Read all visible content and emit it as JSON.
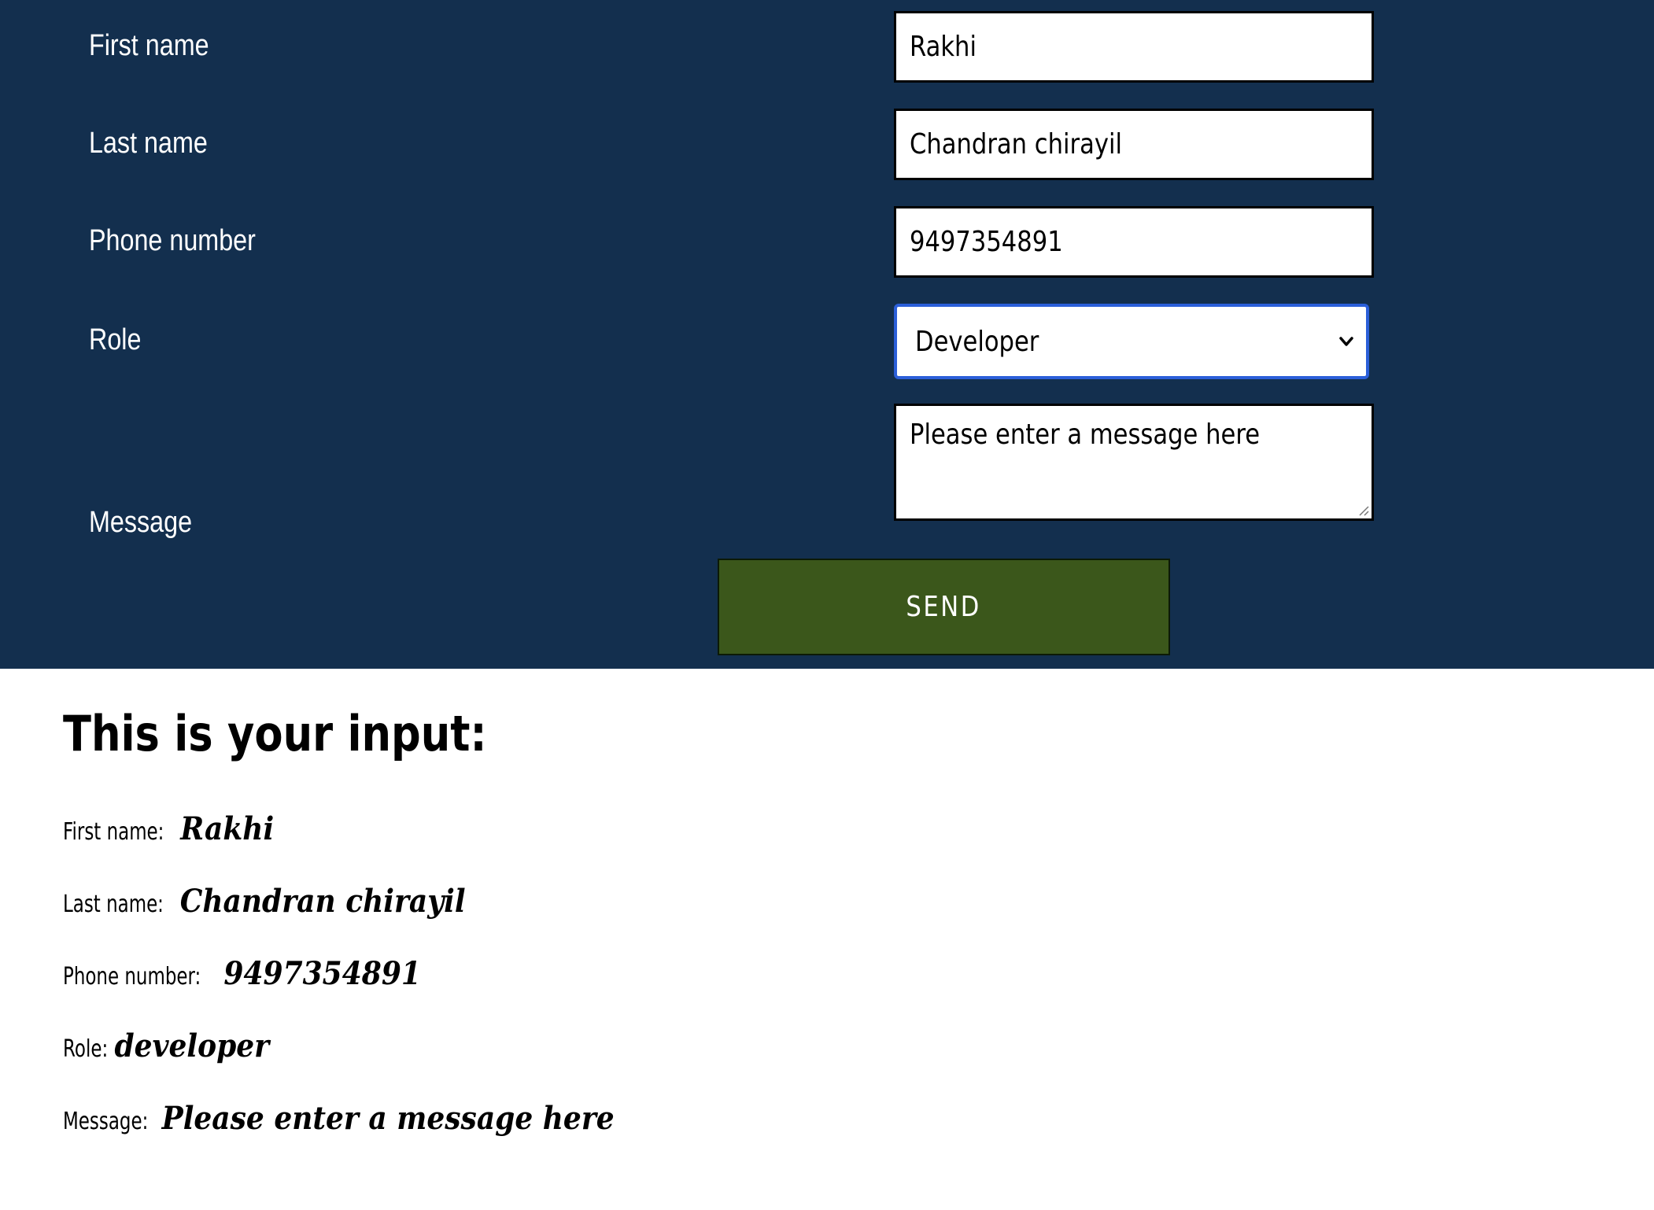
{
  "form": {
    "fields": {
      "first_name": {
        "label": "First name",
        "value": "Rakhi"
      },
      "last_name": {
        "label": "Last name",
        "value": "Chandran chirayil"
      },
      "phone": {
        "label": "Phone number",
        "value": "9497354891"
      },
      "role": {
        "label": "Role",
        "value": "Developer"
      },
      "message": {
        "label": "Message",
        "value": "Please enter a message here"
      }
    },
    "send_label": "SEND"
  },
  "result": {
    "title": "This is your input:",
    "rows": {
      "first_name": {
        "label": "First name:",
        "value": "Rakhi"
      },
      "last_name": {
        "label": "Last name:",
        "value": "Chandran chirayil"
      },
      "phone": {
        "label": "Phone number:",
        "value": "9497354891"
      },
      "role": {
        "label": "Role:",
        "value": "developer"
      },
      "message": {
        "label": "Message:",
        "value": "Please enter a message here"
      }
    }
  },
  "colors": {
    "panel_bg": "#132f4e",
    "send_bg": "#3b571b",
    "focus_border": "#2b5fd9"
  }
}
